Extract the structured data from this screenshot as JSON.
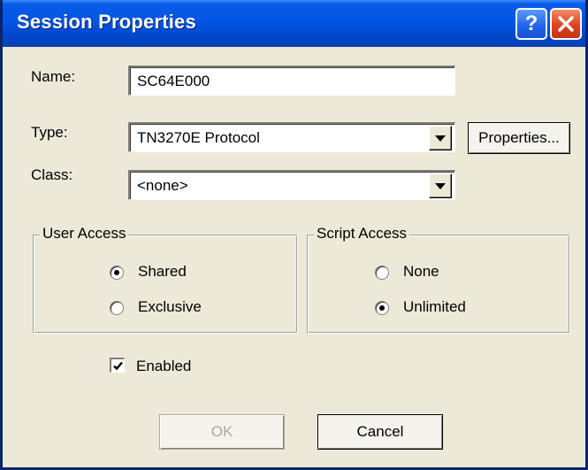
{
  "window": {
    "title": "Session Properties"
  },
  "form": {
    "name_label": "Name:",
    "name_value": "SC64E000",
    "type_label": "Type:",
    "type_value": "TN3270E Protocol",
    "properties_label": "Properties...",
    "class_label": "Class:",
    "class_value": "<none>"
  },
  "user_access": {
    "title": "User Access",
    "options": [
      {
        "label": "Shared",
        "selected": true
      },
      {
        "label": "Exclusive",
        "selected": false
      }
    ]
  },
  "script_access": {
    "title": "Script Access",
    "options": [
      {
        "label": "None",
        "selected": false
      },
      {
        "label": "Unlimited",
        "selected": true
      }
    ]
  },
  "enabled": {
    "label": "Enabled",
    "checked": true
  },
  "buttons": {
    "ok": "OK",
    "ok_disabled": true,
    "cancel": "Cancel"
  },
  "icons": {
    "help": "?",
    "close": "close-icon",
    "dropdown": "chevron-down-icon",
    "check": "check-icon"
  },
  "colors": {
    "titlebar": "#0055e5",
    "dialog_bg": "#ece9d8",
    "close_button": "#e0421c",
    "disabled_text": "#aca899"
  }
}
